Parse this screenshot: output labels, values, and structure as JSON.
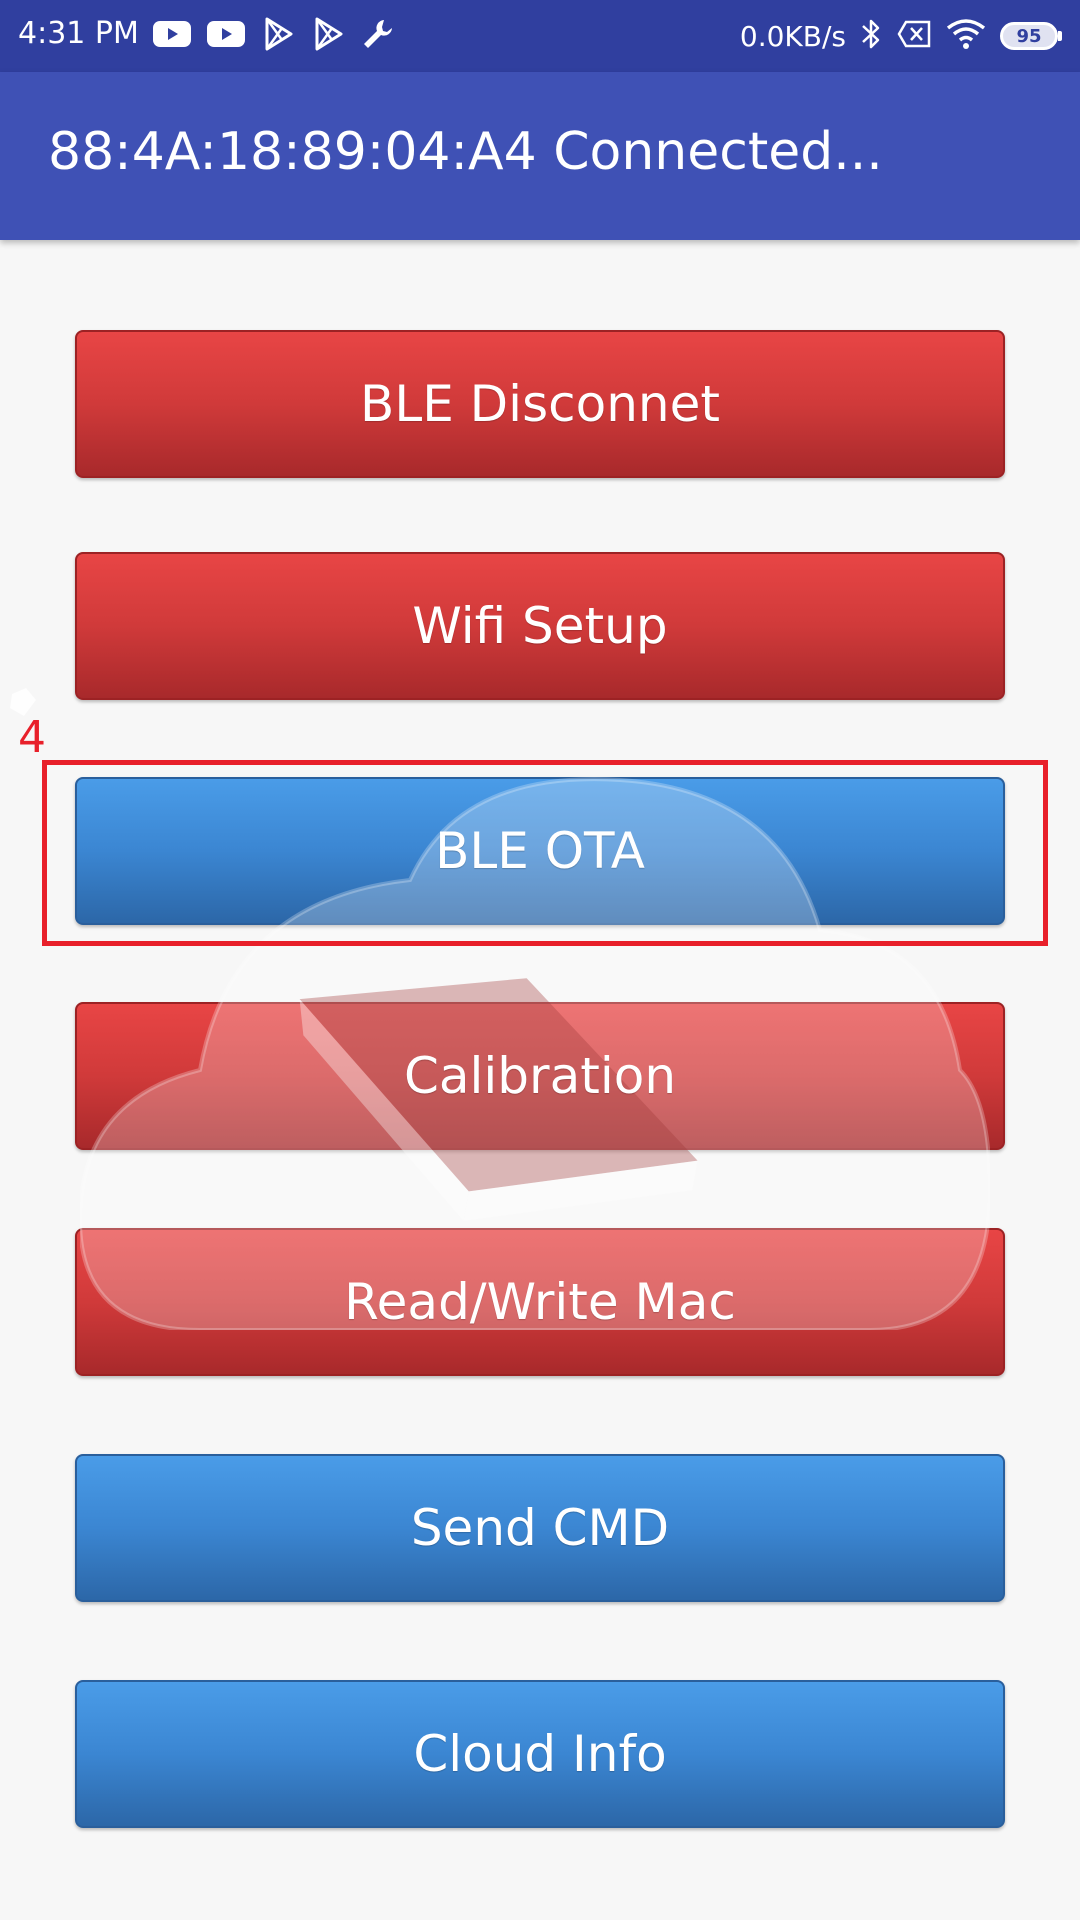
{
  "status_bar": {
    "time": "4:31 PM",
    "net_speed": "0.0KB/s",
    "battery": "95",
    "icons_left": [
      "youtube-icon",
      "youtube-icon",
      "play-store-icon",
      "play-store-icon",
      "wrench-icon"
    ],
    "icons_right": [
      "bluetooth-icon",
      "no-sim-icon",
      "wifi-icon",
      "battery-icon"
    ]
  },
  "app_bar": {
    "title": "88:4A:18:89:04:A4 Connected..."
  },
  "buttons": [
    {
      "label": "BLE Disconnet",
      "color": "red"
    },
    {
      "label": "Wifi Setup",
      "color": "red"
    },
    {
      "label": "BLE OTA",
      "color": "blue"
    },
    {
      "label": "Calibration",
      "color": "red"
    },
    {
      "label": "Read/Write Mac",
      "color": "red"
    },
    {
      "label": "Send CMD",
      "color": "blue"
    },
    {
      "label": "Cloud Info",
      "color": "blue"
    }
  ],
  "annotation": {
    "label": "4"
  },
  "colors": {
    "status_bar": "#303f9f",
    "app_bar": "#3f51b5",
    "button_red": "#d03a3a",
    "button_blue": "#3b86d2",
    "annotation": "#e8202a",
    "background": "#f7f7f7"
  }
}
